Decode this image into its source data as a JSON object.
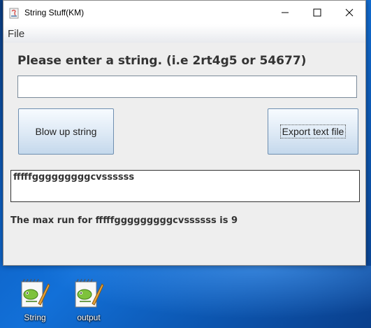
{
  "window": {
    "title": "String Stuff(KM)",
    "icons": {
      "app": "java-app-icon",
      "minimize": "minimize-icon",
      "maximize": "maximize-icon",
      "close": "close-icon"
    }
  },
  "menu": {
    "file": "File"
  },
  "main": {
    "prompt": "Please enter a string. (i.e 2rt4g5 or 54677)",
    "input_value": "",
    "blow_button": "Blow up string",
    "export_button": "Export text file",
    "output_text": "fffffgggggggggcvssssss",
    "result_text": "The max run for fffffgggggggggcvssssss is 9"
  },
  "desktop": {
    "icons": [
      {
        "label": "String",
        "icon": "notepad-plus-plus-icon"
      },
      {
        "label": "output",
        "icon": "notepad-plus-plus-icon"
      }
    ]
  }
}
